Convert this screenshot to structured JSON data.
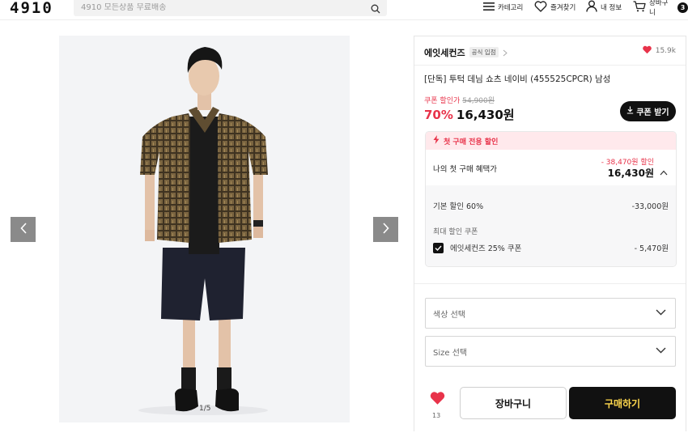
{
  "header": {
    "logo": "4910",
    "search_placeholder": "4910 모든상품 무료배송",
    "nav": [
      {
        "label": "카테고리",
        "icon": "menu-icon"
      },
      {
        "label": "즐겨찾기",
        "icon": "heart-outline-icon"
      },
      {
        "label": "내 정보",
        "icon": "user-icon"
      },
      {
        "label": "장바구니",
        "icon": "cart-icon",
        "badge": "3"
      }
    ]
  },
  "gallery": {
    "pager": "1/5",
    "prev_icon": "chevron-left-icon",
    "next_icon": "chevron-right-icon"
  },
  "product": {
    "brand": "에잇세컨즈",
    "official_tag": "공식 입점",
    "likes": "15.9k",
    "title": "[단독] 투턱 데님 쇼츠 네이비 (455525CPCR) 남성",
    "coupon_price_label": "쿠폰 할인가",
    "original_price": "54,900원",
    "discount_rate": "70%",
    "price": "16,430원",
    "coupon_button": "쿠폰 받기"
  },
  "benefit": {
    "header": "첫 구매 전용 할인",
    "summary_label": "나의 첫 구매 혜택가",
    "summary_discount": "- 38,470원 할인",
    "summary_total": "16,430원",
    "base_label": "기본 할인 60%",
    "base_amount": "-33,000원",
    "max_coupon_label": "최대 할인 쿠폰",
    "coupon_name": "에잇세컨즈 25% 쿠폰",
    "coupon_amount": "- 5,470원"
  },
  "options": {
    "color_placeholder": "색상 선택",
    "size_placeholder": "Size 선택"
  },
  "actions": {
    "like_count": "13",
    "cart_label": "장바구니",
    "buy_label": "구매하기"
  },
  "colors": {
    "accent_red": "#e8334a",
    "buy_text": "#ffd84d",
    "dark": "#111111"
  }
}
